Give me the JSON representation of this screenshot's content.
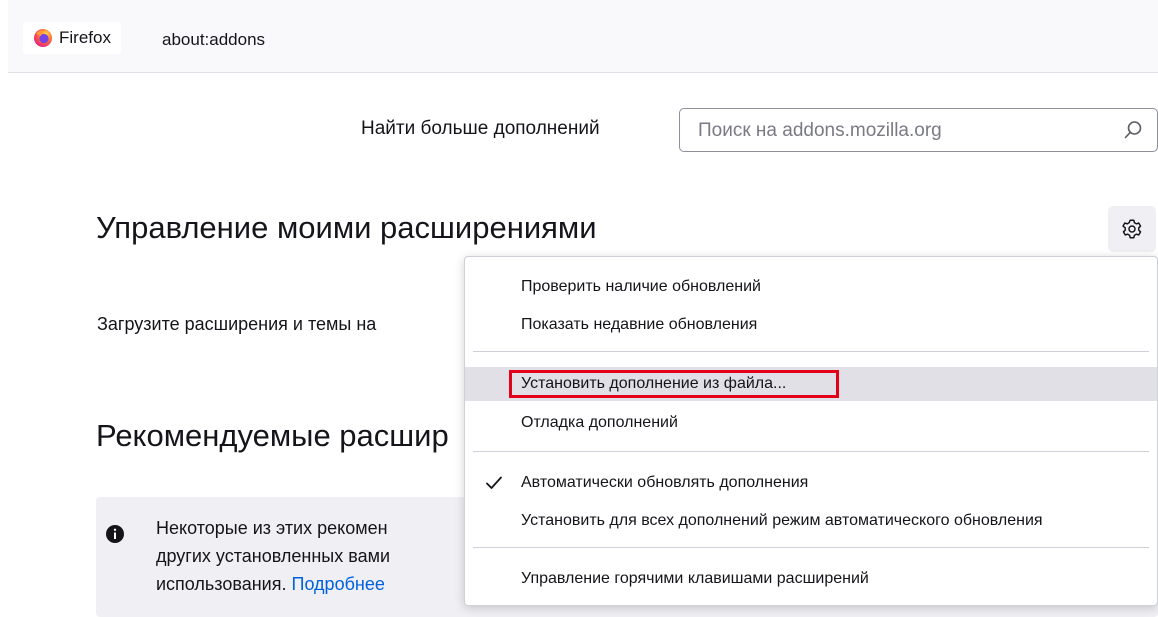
{
  "tab": {
    "label": "Firefox",
    "logo_icon": "firefox-logo-icon"
  },
  "urlbar": {
    "url": "about:addons"
  },
  "search": {
    "label": "Найти больше дополнений",
    "placeholder": "Поиск на addons.mozilla.org",
    "icon": "search-icon"
  },
  "main": {
    "heading": "Управление моими расширениями",
    "description": "Загрузите расширения и темы на",
    "recommended_heading": "Рекомендуемые расшир",
    "notice": {
      "line1": "Некоторые из этих рекомен",
      "line2": "других установленных вами",
      "line3": "использования.",
      "link": "Подробнее",
      "icon": "info-icon"
    }
  },
  "gear_icon": "gear-icon",
  "menu": {
    "items": [
      {
        "label": "Проверить наличие обновлений"
      },
      {
        "label": "Показать недавние обновления"
      },
      {
        "label": "Установить дополнение из файла...",
        "highlighted": true
      },
      {
        "label": "Отладка дополнений"
      },
      {
        "label": "Автоматически обновлять дополнения",
        "checked": true
      },
      {
        "label": "Установить для всех дополнений режим автоматического обновления"
      },
      {
        "label": "Управление горячими клавишами расширений"
      }
    ],
    "highlight_color": "#e3001b"
  }
}
